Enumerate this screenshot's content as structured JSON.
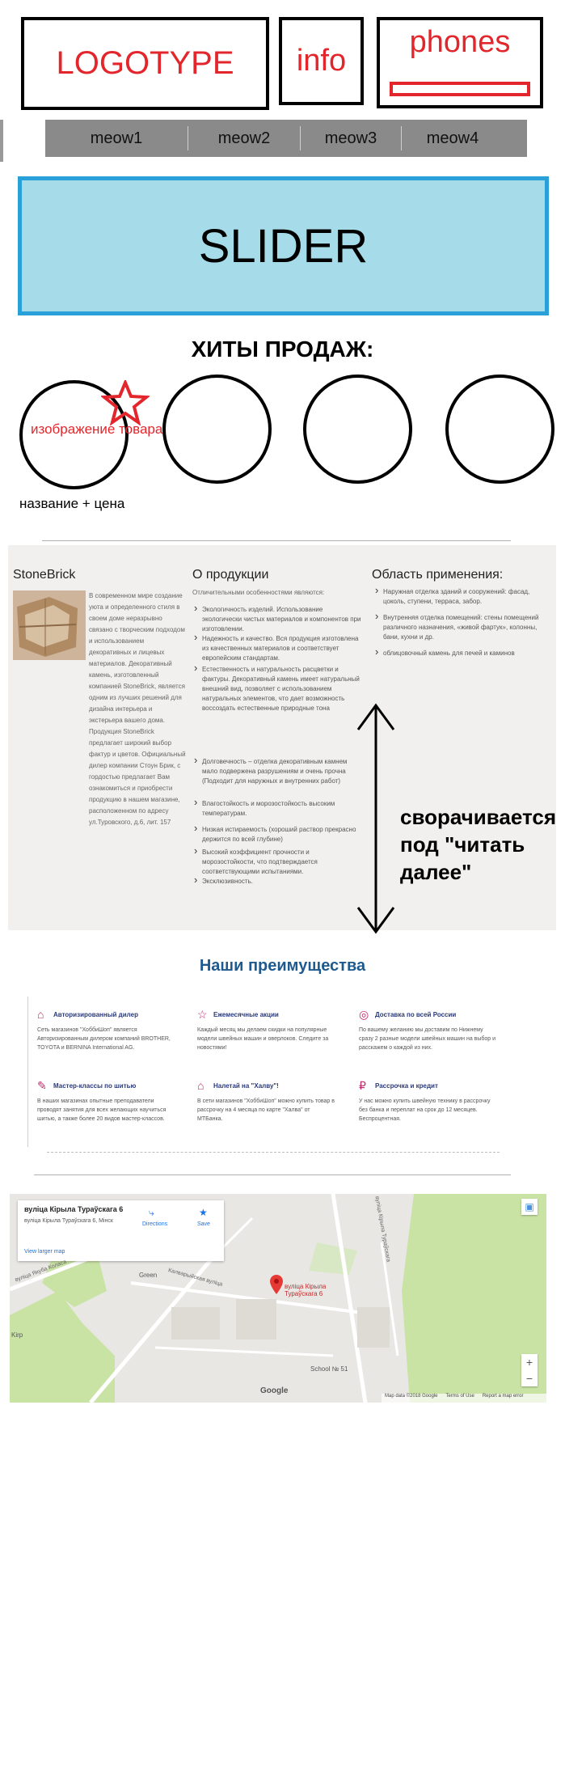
{
  "header": {
    "logo": "LOGOTYPE",
    "info": "info",
    "phones": "phones"
  },
  "nav": {
    "items": [
      {
        "label": "meow1"
      },
      {
        "label": "meow2"
      },
      {
        "label": "meow3"
      },
      {
        "label": "meow4"
      }
    ]
  },
  "slider": {
    "label": "SLIDER"
  },
  "hits": {
    "title": "ХИТЫ ПРОДАЖ:",
    "image_label": "изображение товара",
    "product_caption": "название + цена",
    "product_count": 4,
    "badge_color": "#e3262b"
  },
  "about": {
    "brand_heading": "StoneBrick",
    "brand_text": "В современном мире создание уюта и определенного стиля в своем доме неразрывно связано с творческим подходом и использованием декоративных и лицевых материалов. Декоративный камень, изготовленный компанией StoneBrick, является одним из лучших решений для дизайна интерьера и экстерьера вашего дома. Продукция StoneBrick предлагает широкий выбор фактур и цветов. Официальный дилер компании Стоун Брик, с гордостью предлагает Вам ознакомиться и приобрести продукцию в нашем магазине, расположенном по адресу ул.Туровского, д.6, лит. 157",
    "products_heading": "О продукции",
    "products_intro": "Отличительными особенностями являются:",
    "products_bullets": [
      "Экологичность изделий. Использование экологически чистых материалов и компонентов при изготовлении.",
      "Надежность и качество. Вся продукция изготовлена из качественных материалов и соответствует европейским стандартам.",
      "Естественность и натуральность расцветки и фактуры. Декоративный камень имеет натуральный внешний вид, позволяет с использованием натуральных элементов, что дает возможность воссоздать естественные природные тона",
      "Долговечность – отделка декоративным камнем мало подвержена разрушениям и очень прочна (Подходит для наружных и внутренних работ)",
      "Влагостойкость и морозостойкость высоким температурам.",
      "Низкая истираемость (хороший раствор прекрасно держится по всей глубине)",
      "Высокий коэффициент прочности и морозостойкости, что подтверждается соответствующими испытаниями.",
      "Эксклюзивность."
    ],
    "usage_heading": "Область применения:",
    "usage_bullets": [
      "Наружная отделка зданий и сооружений: фасад, цоколь, ступени, терраса, забор.",
      "Внутренняя отделка помещений: стены помещений различного назначения, «живой фартук», колонны, бани, кухни и др.",
      "облицовочный камень для печей и каминов"
    ],
    "collapse_note": "сворачивается под \"читать далее\""
  },
  "advantages": {
    "title": "Наши преимущества",
    "items": [
      {
        "icon": "tag-icon",
        "title": "Авторизированный дилер",
        "text": "Сеть магазинов \"ХоббиШоп\" является Авторизированным дилером компаний BROTHER, TOYOTA и BERNINA International AG."
      },
      {
        "icon": "star-icon",
        "title": "Ежемесячные акции",
        "text": "Каждый месяц мы делаем скидки на популярные модели швейных машин и оверлоков. Следите за новостями!"
      },
      {
        "icon": "globe-icon",
        "title": "Доставка по всей России",
        "text": "По вашему желанию мы доставим по Нижнему сразу 2 разные модели швейных машин на выбор и расскажем о каждой из них."
      },
      {
        "icon": "pencil-icon",
        "title": "Мастер-классы по шитью",
        "text": "В наших магазинах опытные преподаватели проводят занятия для всех желающих научиться шитью, а также более 20 видов мастер-классов."
      },
      {
        "icon": "tag-icon",
        "title": "Налетай на \"Халву\"!",
        "text": "В сети магазинов \"ХоббиШоп\" можно купить товар в рассрочку на 4 месяца по карте \"Халва\" от МТБанка."
      },
      {
        "icon": "ruble-icon",
        "title": "Рассрочка и кредит",
        "text": "У нас можно купить швейную технику в рассрочку без банка и переплат на срок до 12 месяцев. Беспроцентная."
      }
    ]
  },
  "map": {
    "place_title": "вуліца Кірыла Тураўскага 6",
    "place_address": "вуліца Кірыла Тураўскага 6, Мінск",
    "directions": "Directions",
    "save": "Save",
    "view_larger": "View larger map",
    "marker_label": "вуліца Кірыла Тураўскага 6",
    "poi_green": "Green",
    "poi_school": "School № 51",
    "poi_kirp": "Kirp",
    "street_1": "вуліца Кірыла Тураўскага",
    "street_2": "Калварыйская вуліца",
    "street_3": "вуліца Якуба Коласа",
    "google": "Google",
    "footer_data": "Map data ©2018 Google",
    "footer_terms": "Terms of Use",
    "footer_report": "Report a map error",
    "zoom_in": "+",
    "zoom_out": "−",
    "park_color": "#c9e3a4"
  }
}
